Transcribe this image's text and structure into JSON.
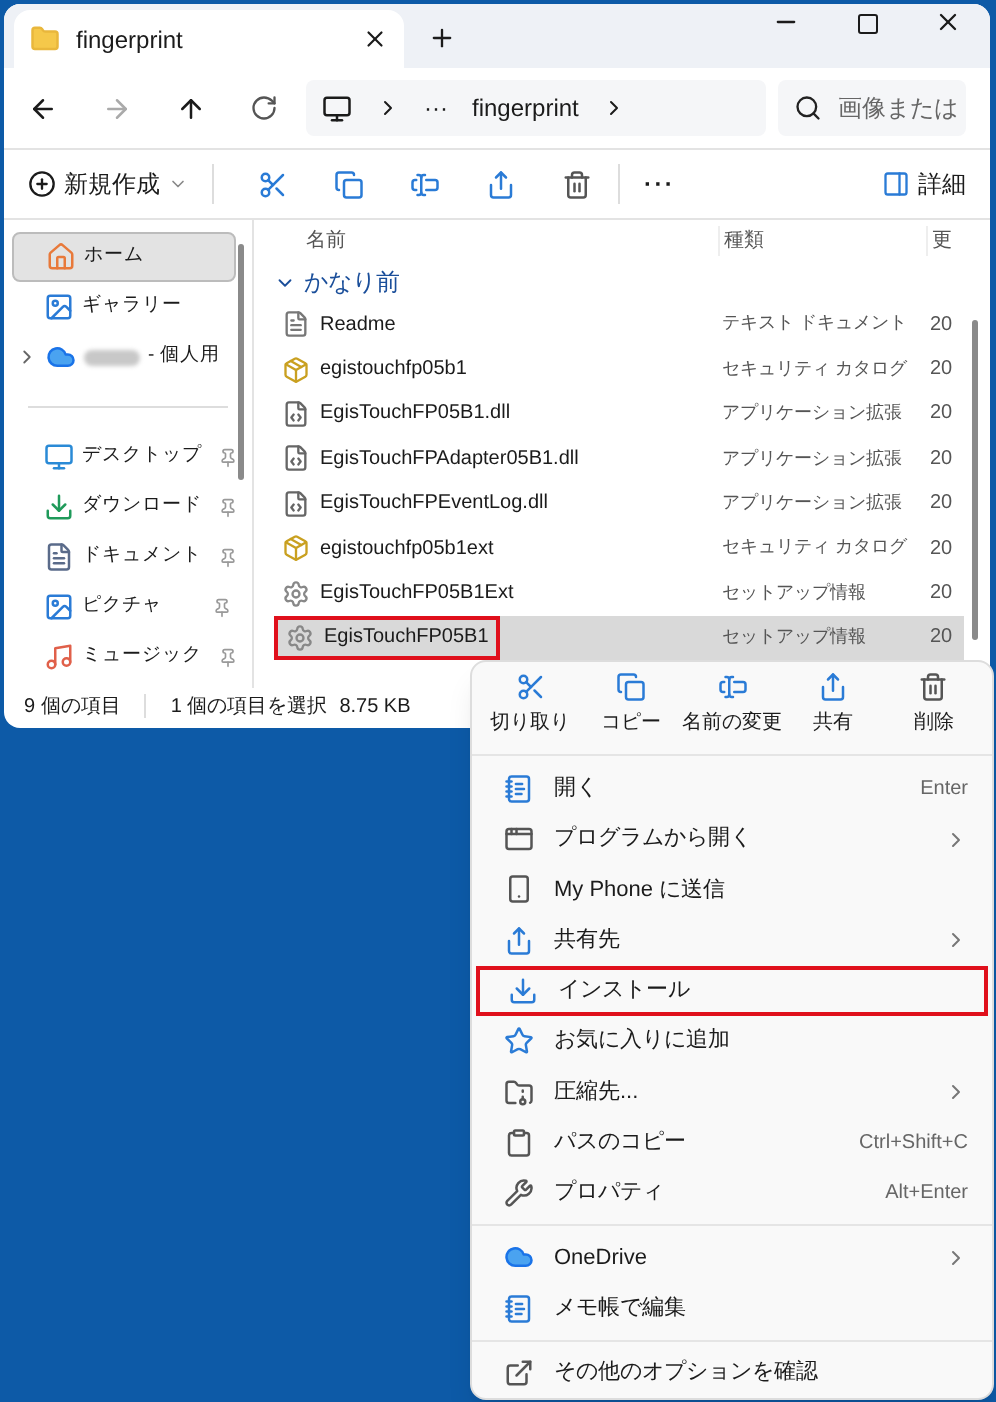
{
  "window": {
    "tab_title": "fingerprint",
    "address": {
      "ellipsis": "···",
      "folder": "fingerprint"
    },
    "search": {
      "placeholder": "画像または"
    }
  },
  "toolbar": {
    "new": "新規作成",
    "details": "詳細",
    "more": "···"
  },
  "sidebar": {
    "items": [
      {
        "label": "ホーム",
        "selected": true
      },
      {
        "label": "ギャラリー",
        "selected": false
      },
      {
        "label": "- 個人用",
        "selected": false,
        "expandable": true,
        "blurred": true
      },
      {
        "label": "デスクトップ",
        "selected": false,
        "pinned": true
      },
      {
        "label": "ダウンロード",
        "selected": false,
        "pinned": true
      },
      {
        "label": "ドキュメント",
        "selected": false,
        "pinned": true
      },
      {
        "label": "ピクチャ",
        "selected": false,
        "pinned": true
      },
      {
        "label": "ミュージック",
        "selected": false,
        "pinned": true
      }
    ]
  },
  "table": {
    "columns": [
      "名前",
      "種類",
      "更"
    ],
    "group": "かなり前",
    "rows": [
      {
        "kind": "text",
        "name": "Readme",
        "type": "テキスト ドキュメント",
        "date": "20",
        "selected": false,
        "highlighted": false
      },
      {
        "kind": "catalog",
        "name": "egistouchfp05b1",
        "type": "セキュリティ カタログ",
        "date": "20",
        "selected": false,
        "highlighted": false
      },
      {
        "kind": "dll",
        "name": "EgisTouchFP05B1.dll",
        "type": "アプリケーション拡張",
        "date": "20",
        "selected": false,
        "highlighted": false
      },
      {
        "kind": "dll",
        "name": "EgisTouchFPAdapter05B1.dll",
        "type": "アプリケーション拡張",
        "date": "20",
        "selected": false,
        "highlighted": false
      },
      {
        "kind": "dll",
        "name": "EgisTouchFPEventLog.dll",
        "type": "アプリケーション拡張",
        "date": "20",
        "selected": false,
        "highlighted": false
      },
      {
        "kind": "catalog",
        "name": "egistouchfp05b1ext",
        "type": "セキュリティ カタログ",
        "date": "20",
        "selected": false,
        "highlighted": false
      },
      {
        "kind": "setup",
        "name": "EgisTouchFP05B1Ext",
        "type": "セットアップ情報",
        "date": "20",
        "selected": false,
        "highlighted": false
      },
      {
        "kind": "setup",
        "name": "EgisTouchFP05B1",
        "type": "セットアップ情報",
        "date": "20",
        "selected": true,
        "highlighted": true
      }
    ]
  },
  "status_bar": {
    "count": "9 個の項目",
    "selection": "1 個の項目を選択",
    "size": "8.75 KB"
  },
  "context_menu": {
    "actions": [
      "切り取り",
      "コピー",
      "名前の変更",
      "共有",
      "削除"
    ],
    "groups": [
      [
        {
          "label": "開く",
          "shortcut": "Enter",
          "submenu": false,
          "highlighted": false
        },
        {
          "label": "プログラムから開く",
          "submenu": true,
          "highlighted": false
        },
        {
          "label": "My Phone に送信",
          "submenu": false,
          "highlighted": false
        },
        {
          "label": "共有先",
          "submenu": true,
          "highlighted": false
        },
        {
          "label": "インストール",
          "submenu": false,
          "highlighted": true
        },
        {
          "label": "お気に入りに追加",
          "submenu": false,
          "highlighted": false
        },
        {
          "label": "圧縮先...",
          "submenu": true,
          "highlighted": false
        },
        {
          "label": "パスのコピー",
          "shortcut": "Ctrl+Shift+C",
          "submenu": false,
          "highlighted": false
        },
        {
          "label": "プロパティ",
          "shortcut": "Alt+Enter",
          "submenu": false,
          "highlighted": false
        }
      ],
      [
        {
          "label": "OneDrive",
          "submenu": true,
          "highlighted": false
        },
        {
          "label": "メモ帳で編集",
          "submenu": false,
          "highlighted": false
        }
      ],
      [
        {
          "label": "その他のオプションを確認",
          "submenu": false,
          "highlighted": false
        }
      ]
    ]
  }
}
